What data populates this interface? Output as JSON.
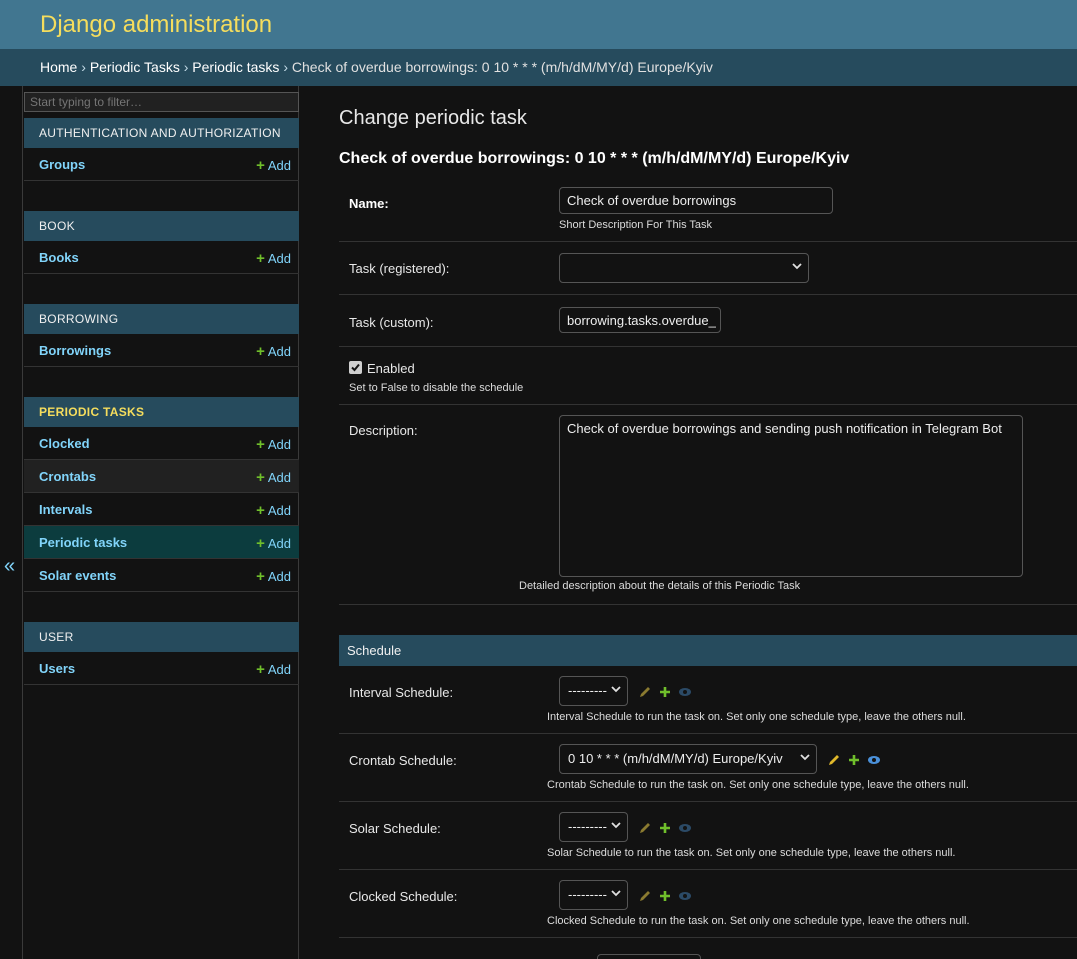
{
  "header": {
    "title": "Django administration"
  },
  "breadcrumbs": [
    {
      "label": "Home"
    },
    {
      "label": "Periodic Tasks"
    },
    {
      "label": "Periodic tasks"
    },
    {
      "label": "Check of overdue borrowings: 0 10 * * * (m/h/dM/MY/d) Europe/Kyiv"
    }
  ],
  "breadcrumb_separator": "›",
  "sidebar": {
    "filter_placeholder": "Start typing to filter…",
    "add_label": "Add",
    "toggle_icon": "«",
    "modules": [
      {
        "caption": "AUTHENTICATION AND AUTHORIZATION",
        "models": [
          {
            "label": "Groups"
          }
        ]
      },
      {
        "caption": "BOOK",
        "models": [
          {
            "label": "Books"
          }
        ]
      },
      {
        "caption": "BORROWING",
        "models": [
          {
            "label": "Borrowings"
          }
        ]
      },
      {
        "caption": "PERIODIC TASKS",
        "active": true,
        "models": [
          {
            "label": "Clocked"
          },
          {
            "label": "Crontabs"
          },
          {
            "label": "Intervals"
          },
          {
            "label": "Periodic tasks",
            "current": true
          },
          {
            "label": "Solar events"
          }
        ]
      },
      {
        "caption": "USER",
        "models": [
          {
            "label": "Users"
          }
        ]
      }
    ]
  },
  "content": {
    "page_title": "Change periodic task",
    "object_title": "Check of overdue borrowings: 0 10 * * * (m/h/dM/MY/d) Europe/Kyiv",
    "fields": {
      "name": {
        "label": "Name:",
        "value": "Check of overdue borrowings",
        "help": "Short Description For This Task"
      },
      "task_registered": {
        "label": "Task (registered):",
        "value": ""
      },
      "task_custom": {
        "label": "Task (custom):",
        "value": "borrowing.tasks.overdue_"
      },
      "enabled": {
        "label": "Enabled",
        "checked": true,
        "help": "Set to False to disable the schedule"
      },
      "description": {
        "label": "Description:",
        "value": "Check of overdue borrowings and sending push notification in Telegram Bot",
        "help": "Detailed description about the details of this Periodic Task"
      }
    },
    "schedule": {
      "caption": "Schedule",
      "rows": [
        {
          "label": "Interval Schedule:",
          "value": "---------",
          "help": "Interval Schedule to run the task on. Set only one schedule type, leave the others null."
        },
        {
          "label": "Crontab Schedule:",
          "value": "0 10 * * * (m/h/dM/MY/d) Europe/Kyiv",
          "help": "Crontab Schedule to run the task on. Set only one schedule type, leave the others null."
        },
        {
          "label": "Solar Schedule:",
          "value": "---------",
          "help": "Solar Schedule to run the task on. Set only one schedule type, leave the others null."
        },
        {
          "label": "Clocked Schedule:",
          "value": "---------",
          "help": "Clocked Schedule to run the task on. Set only one schedule type, leave the others null."
        }
      ]
    }
  },
  "colors": {
    "header_bg": "#417690",
    "branding": "#f5dd5d",
    "breadcrumbs_bg": "#264b5d",
    "link": "#81d4fa",
    "add_plus": "#70bf2b",
    "current_row": "#0c3c3e"
  }
}
